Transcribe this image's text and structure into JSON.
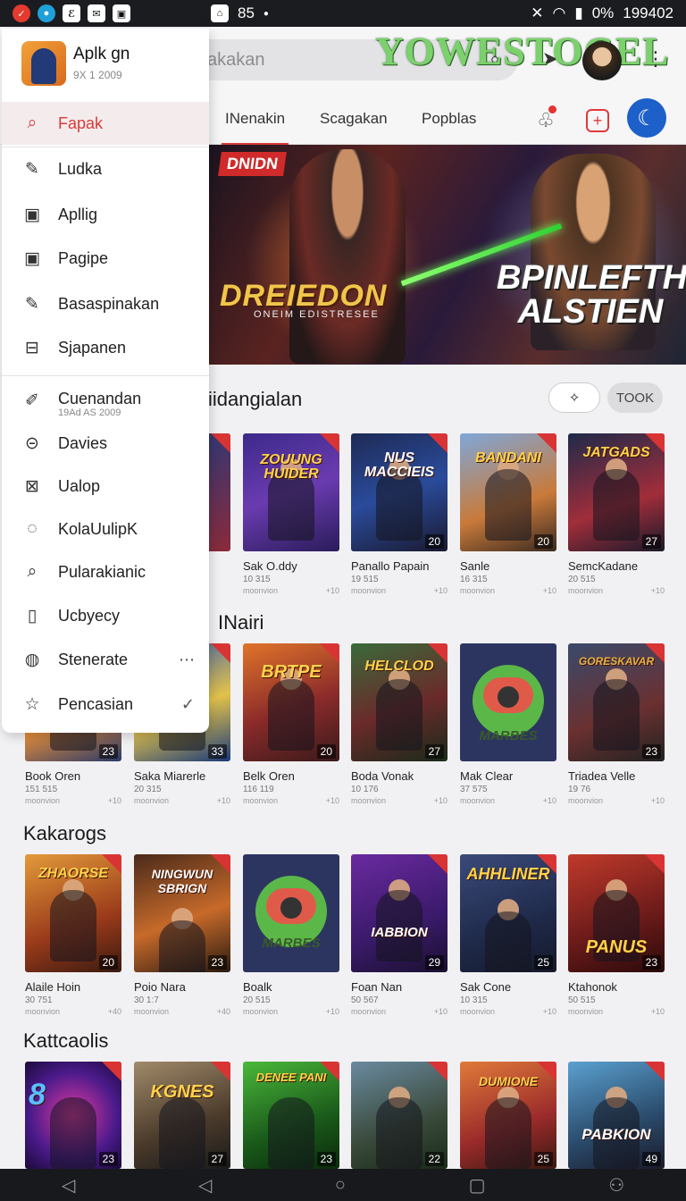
{
  "status_bar": {
    "center_text": "85",
    "right_text": "0%",
    "time": "199402"
  },
  "top_bar": {
    "search_placeholder": "akakan",
    "brand": "YOWESTOGEL"
  },
  "tabs": [
    {
      "label": "INenakin",
      "active": true
    },
    {
      "label": "Scagakan",
      "active": false
    },
    {
      "label": "Popblas",
      "active": false
    }
  ],
  "banner": {
    "tag": "DNIDN",
    "title_left": "DREIEDON",
    "subtitle_left": "ONEIM EDISTRESEE",
    "title_right": "BPINLEFTH ALSTIEN"
  },
  "drawer": {
    "app_name": "Aplk gn",
    "app_version": "9X 1 2009",
    "items": [
      {
        "label": "Fapak",
        "icon": "search-icon",
        "active": true
      },
      {
        "label": "Ludka",
        "icon": "edit-icon"
      },
      {
        "label": "Apllig",
        "icon": "app-icon"
      },
      {
        "label": "Pagipe",
        "icon": "page-icon"
      },
      {
        "label": "Basaspinakan",
        "icon": "compose-icon"
      },
      {
        "label": "Sjapanen",
        "icon": "minus-box-icon"
      },
      {
        "label": "Cuenandan",
        "sub": "19Ad AS 2009",
        "icon": "pencil-icon"
      },
      {
        "label": "Davies",
        "icon": "device-icon"
      },
      {
        "label": "Ualop",
        "icon": "mail-icon"
      },
      {
        "label": "KolaUulipK",
        "icon": "check-circle-icon"
      },
      {
        "label": "Pularakianic",
        "icon": "search-icon"
      },
      {
        "label": "Ucbyecy",
        "icon": "document-icon"
      },
      {
        "label": "Stenerate",
        "icon": "chat-icon",
        "trail": "⋯"
      },
      {
        "label": "Pencasian",
        "icon": "star-icon",
        "trail": "✓"
      }
    ]
  },
  "sections": [
    {
      "title": "kiidangialan",
      "chip_right": "TOOK",
      "tiles": [
        {
          "name": "",
          "meta": "",
          "logo": "",
          "num": ""
        },
        {
          "name": "Sak O.ddy",
          "meta": "10 315",
          "stats_left": "moonvion",
          "stats_right": "+10",
          "logo": "ZOUUNG HUIDER",
          "num": ""
        },
        {
          "name": "Panallo Papain",
          "meta": "19 515",
          "stats_left": "moonvion",
          "stats_right": "+10",
          "logo": "NUS MACCIEIS",
          "num": "20"
        },
        {
          "name": "Sanle",
          "meta": "16 315",
          "stats_left": "moonvion",
          "stats_right": "+10",
          "logo": "BANDANI",
          "num": "20"
        },
        {
          "name": "SemcKadane",
          "meta": "20 515",
          "stats_left": "moonvion",
          "stats_right": "+10",
          "logo": "JATGADS",
          "num": "27"
        }
      ]
    },
    {
      "title": "INairi",
      "tiles": [
        {
          "name": "Book Oren",
          "meta": "151 515",
          "stats_left": "moonvion",
          "stats_right": "+10",
          "logo": "",
          "num": "23"
        },
        {
          "name": "Saka Miarerle",
          "meta": "20 315",
          "stats_left": "moonvion",
          "stats_right": "+10",
          "logo": "",
          "num": "33"
        },
        {
          "name": "Belk Oren",
          "meta": "116 119",
          "stats_left": "moonvion",
          "stats_right": "+10",
          "logo": "BRTPE",
          "num": "20"
        },
        {
          "name": "Boda Vonak",
          "meta": "10 176",
          "stats_left": "moonvion",
          "stats_right": "+10",
          "logo": "HELCLOD",
          "num": "27"
        },
        {
          "name": "Mak Clear",
          "meta": "37 575",
          "stats_left": "moonvion",
          "stats_right": "+10",
          "logo": "MARBES",
          "num": ""
        },
        {
          "name": "Triadea Velle",
          "meta": "19 76",
          "stats_left": "moonvion",
          "stats_right": "+10",
          "logo": "GORESKAVAR",
          "num": "23"
        }
      ]
    },
    {
      "title": "Kakarogs",
      "tiles": [
        {
          "name": "Alaile Hoin",
          "meta": "30 751",
          "stats_left": "moonvion",
          "stats_right": "+40",
          "logo": "ZHAORSE",
          "num": "20"
        },
        {
          "name": "Poio Nara",
          "meta": "30 1:7",
          "stats_left": "moonvion",
          "stats_right": "+40",
          "logo": "NINGWUN SBRIGN",
          "num": "23"
        },
        {
          "name": "Boalk",
          "meta": "20 515",
          "stats_left": "moonvion",
          "stats_right": "+10",
          "logo": "MARBES",
          "num": ""
        },
        {
          "name": "Foan Nan",
          "meta": "50 567",
          "stats_left": "moonvion",
          "stats_right": "+10",
          "logo": "IABBION",
          "num": "29"
        },
        {
          "name": "Sak Cone",
          "meta": "10 315",
          "stats_left": "moonvion",
          "stats_right": "+10",
          "logo": "AHHLINER",
          "num": "25"
        },
        {
          "name": "Ktahonok",
          "meta": "50 515",
          "stats_left": "moonvion",
          "stats_right": "+10",
          "logo": "PANUS",
          "num": "23"
        }
      ]
    },
    {
      "title": "Kattcaolis",
      "tiles": [
        {
          "logo": "8",
          "num": "23"
        },
        {
          "logo": "KGNES",
          "num": "27"
        },
        {
          "logo": "DENEE PANI",
          "num": "23"
        },
        {
          "logo": "",
          "num": "22"
        },
        {
          "logo": "DUMIONE",
          "num": "25"
        },
        {
          "logo": "PABKION",
          "num": "49"
        }
      ]
    }
  ],
  "colors": {
    "accent": "#d93a3a",
    "brand_green": "#7bd16b",
    "nav_blue": "#1e60c9"
  }
}
